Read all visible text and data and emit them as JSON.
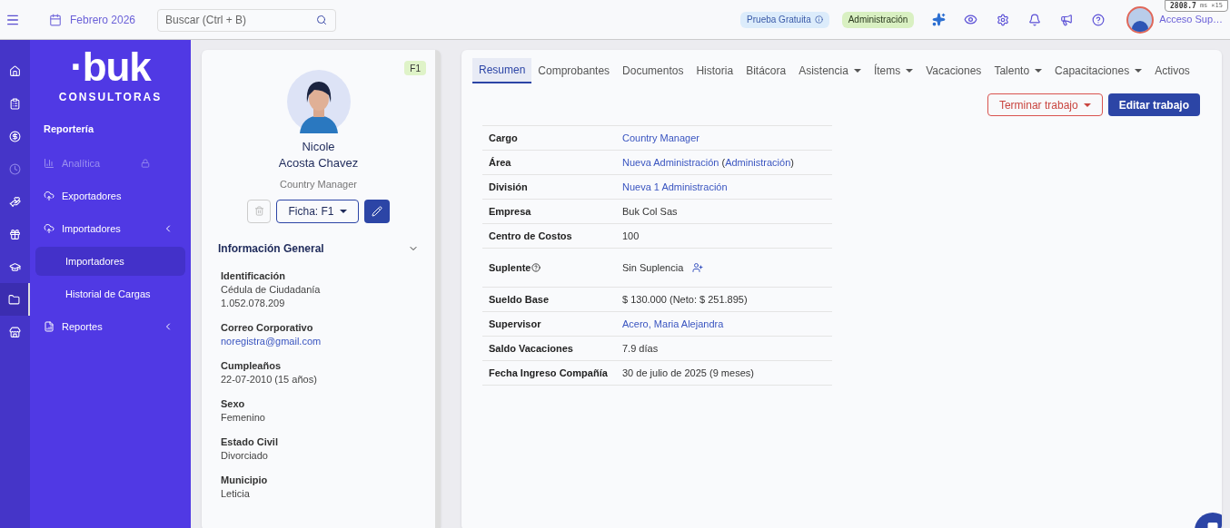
{
  "topbar": {
    "period": "Febrero 2026",
    "search": {
      "placeholder": "Buscar (Ctrl + B)"
    },
    "badges": [
      {
        "label": "Prueba Gratuita",
        "kind": "trial"
      },
      {
        "label": "Administración",
        "kind": "role"
      }
    ],
    "user": {
      "name": "Acceso Sup…"
    },
    "perf_overlay": {
      "value": "2808.7",
      "unit": "ms",
      "count": "×15"
    }
  },
  "rail": [
    {
      "kind": "home",
      "selected": false
    },
    {
      "kind": "clipboard",
      "selected": false
    },
    {
      "kind": "money",
      "selected": false
    },
    {
      "kind": "clock",
      "selected": false
    },
    {
      "kind": "hand",
      "selected": false
    },
    {
      "kind": "gift",
      "selected": false
    },
    {
      "kind": "school",
      "selected": false
    },
    {
      "kind": "folder",
      "selected": true
    },
    {
      "kind": "store",
      "selected": false
    }
  ],
  "sidebar": {
    "logo": "·buk",
    "subtitle": "CONSULTORAS",
    "items": [
      {
        "kind": "header",
        "label": "Reportería"
      },
      {
        "kind": "item",
        "label": "Analítica",
        "disabled": true,
        "locked": true
      },
      {
        "kind": "item",
        "label": "Exportadores",
        "disabled": false
      },
      {
        "kind": "group",
        "label": "Importadores",
        "disabled": false,
        "children": [
          {
            "label": "Importadores",
            "selected": true
          },
          {
            "label": "Historial de Cargas",
            "selected": false
          }
        ]
      },
      {
        "kind": "group",
        "label": "Reportes",
        "disabled": false
      }
    ]
  },
  "profile": {
    "badge": "F1",
    "first_name": "Nicole",
    "last_name": "Acosta Chavez",
    "role": "Country Manager",
    "ficha": "Ficha: F1",
    "section": {
      "title": "Información General",
      "expanded": true
    },
    "fields": [
      {
        "label": "Identificación",
        "values": [
          "Cédula de Ciudadanía",
          "1.052.078.209"
        ],
        "kind": "text"
      },
      {
        "label": "Correo Corporativo",
        "values": [
          "noregistra@gmail.com"
        ],
        "kind": "link"
      },
      {
        "label": "Cumpleaños",
        "values": [
          "22-07-2010 (15 años)"
        ],
        "kind": "text"
      },
      {
        "label": "Sexo",
        "values": [
          "Femenino"
        ],
        "kind": "text"
      },
      {
        "label": "Estado Civil",
        "values": [
          "Divorciado"
        ],
        "kind": "text"
      },
      {
        "label": "Municipio",
        "values": [
          "Leticia"
        ],
        "kind": "text"
      }
    ]
  },
  "tabs": [
    {
      "label": "Resumen",
      "selected": true,
      "dropdown": false
    },
    {
      "label": "Comprobantes",
      "selected": false,
      "dropdown": false
    },
    {
      "label": "Documentos",
      "selected": false,
      "dropdown": false
    },
    {
      "label": "Historia",
      "selected": false,
      "dropdown": false
    },
    {
      "label": "Bitácora",
      "selected": false,
      "dropdown": false
    },
    {
      "label": "Asistencia",
      "selected": false,
      "dropdown": true
    },
    {
      "label": "Ítems",
      "selected": false,
      "dropdown": true
    },
    {
      "label": "Vacaciones",
      "selected": false,
      "dropdown": false
    },
    {
      "label": "Talento",
      "selected": false,
      "dropdown": true
    },
    {
      "label": "Capacitaciones",
      "selected": false,
      "dropdown": true
    },
    {
      "label": "Activos",
      "selected": false,
      "dropdown": false
    }
  ],
  "actions": [
    {
      "label": "Terminar trabajo",
      "kind": "outline-danger"
    },
    {
      "label": "Editar trabajo",
      "kind": "primary"
    }
  ],
  "summary": [
    {
      "label": "Cargo",
      "parts": [
        {
          "text": "Country Manager",
          "link": true
        }
      ]
    },
    {
      "label": "Área",
      "parts": [
        {
          "text": "Nueva Administración",
          "link": true
        },
        {
          "text": " (",
          "link": false
        },
        {
          "text": "Administración",
          "link": true
        },
        {
          "text": ")",
          "link": false
        }
      ]
    },
    {
      "label": "División",
      "parts": [
        {
          "text": "Nueva 1 Administración",
          "link": true
        }
      ]
    },
    {
      "label": "Empresa",
      "parts": [
        {
          "text": "Buk Col Sas",
          "link": false
        }
      ]
    },
    {
      "label": "Centro de Costos",
      "parts": [
        {
          "text": "100",
          "link": false
        }
      ]
    },
    {
      "label": "Suplente",
      "help": true,
      "add": true,
      "parts": [
        {
          "text": "Sin Suplencia",
          "link": false
        }
      ]
    },
    {
      "label": "Sueldo Base",
      "parts": [
        {
          "text": "$ 130.000 (Neto: $ 251.895)",
          "link": false
        }
      ]
    },
    {
      "label": "Supervisor",
      "parts": [
        {
          "text": "Acero, Maria Alejandra",
          "link": true
        }
      ]
    },
    {
      "label": "Saldo Vacaciones",
      "parts": [
        {
          "text": "7.9 días",
          "link": false
        }
      ]
    },
    {
      "label": "Fecha Ingreso Compañía",
      "parts": [
        {
          "text": "30 de julio de 2025 (9 meses)",
          "link": false
        }
      ]
    }
  ]
}
